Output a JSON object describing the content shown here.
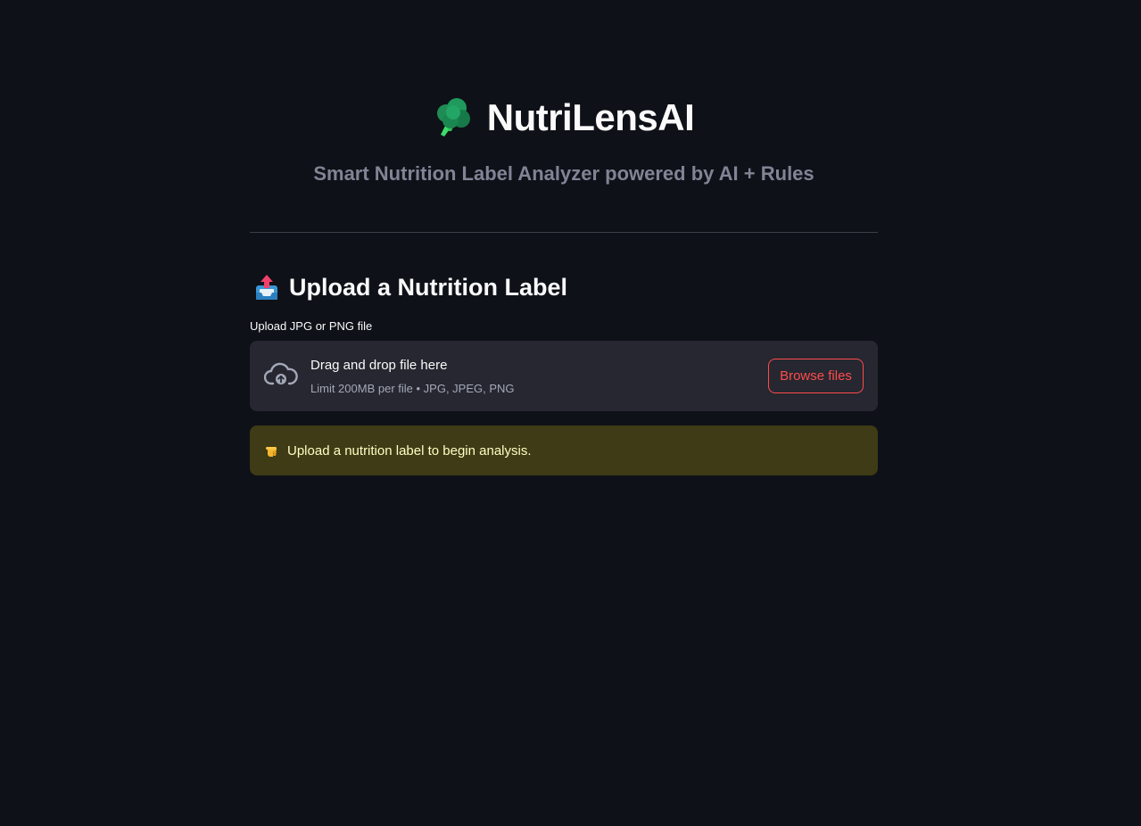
{
  "header": {
    "title": "NutriLensAI",
    "subtitle": "Smart Nutrition Label Analyzer powered by AI + Rules",
    "logo_icon": "broccoli-icon"
  },
  "upload_section": {
    "title": "Upload a Nutrition Label",
    "title_icon": "inbox-tray-icon",
    "field_label": "Upload JPG or PNG file",
    "dropzone": {
      "icon": "cloud-upload-icon",
      "main_text": "Drag and drop file here",
      "sub_text": "Limit 200MB per file • JPG, JPEG, PNG"
    },
    "browse_label": "Browse files"
  },
  "alert": {
    "icon": "pointing-hand-icon",
    "text": "Upload a nutrition label to begin analysis."
  },
  "colors": {
    "background": "#0e1117",
    "surface": "#262730",
    "accent": "#ff4b4b",
    "warning_bg": "#3e3b16",
    "warning_text": "#ffffc2",
    "muted_text": "#808495"
  }
}
